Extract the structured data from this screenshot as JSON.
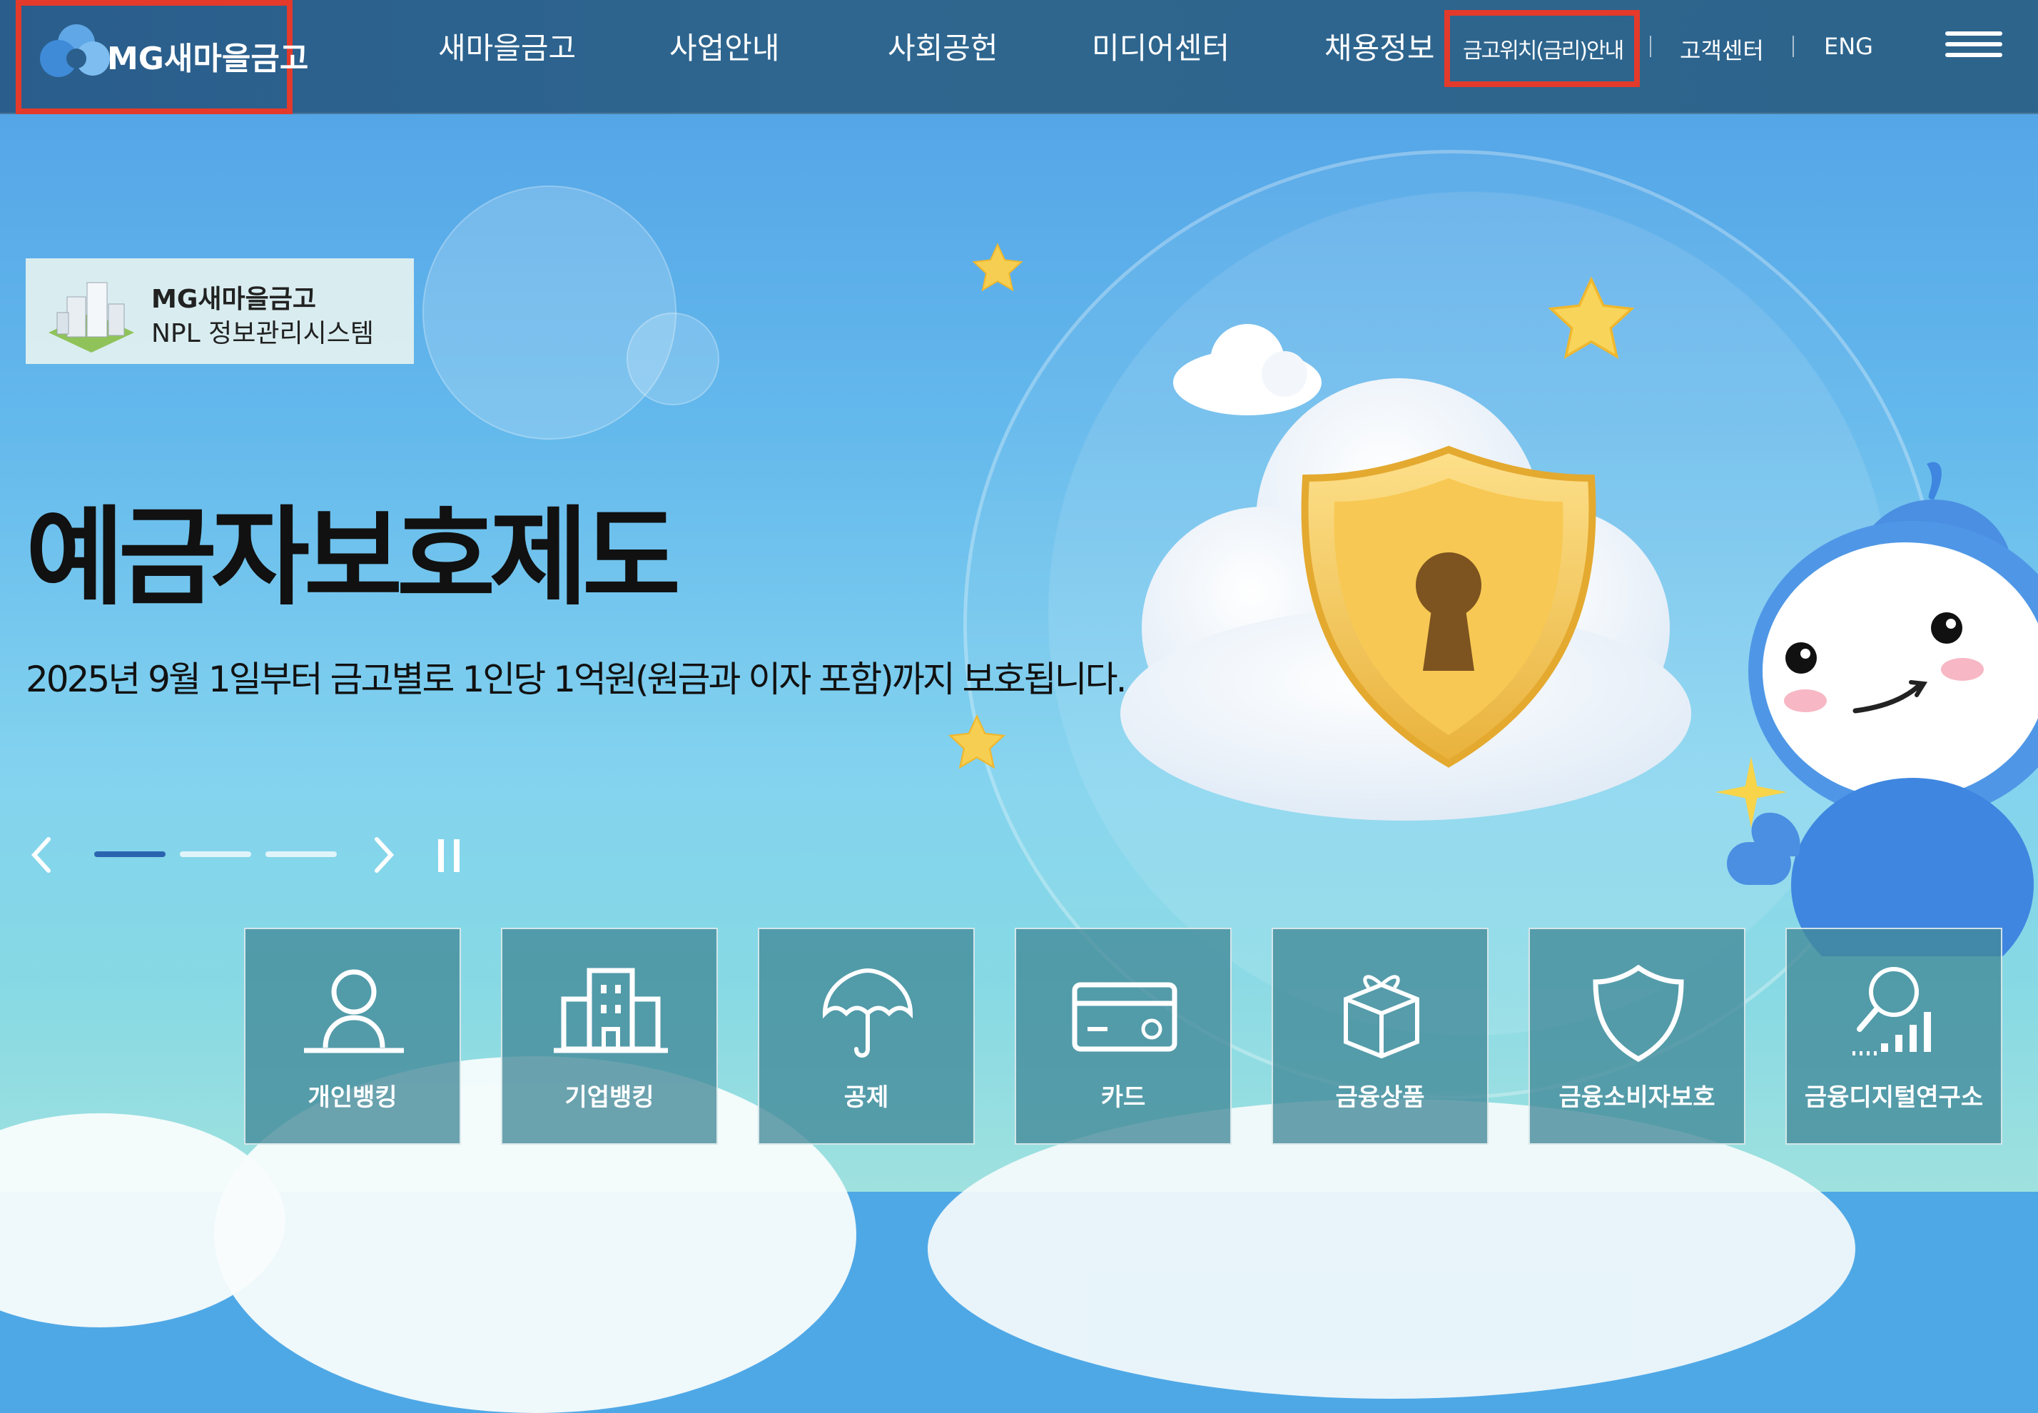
{
  "header": {
    "logo_text": "MG새마을금고",
    "nav": [
      "새마을금고",
      "사업안내",
      "사회공헌",
      "미디어센터",
      "채용정보"
    ],
    "utility": {
      "rate_info": "금고위치(금리)안내",
      "customer_center": "고객센터",
      "eng": "ENG"
    },
    "menu_icon": "hamburger-icon"
  },
  "npl_banner": {
    "title": "MG새마을금고",
    "subtitle": "NPL 정보관리시스템"
  },
  "hero": {
    "headline": "예금자보호제도",
    "subline": "2025년 9월 1일부터 금고별로 1인당 1억원(원금과 이자 포함)까지 보호됩니다.",
    "slide_count": 3,
    "active_slide": 1
  },
  "quick_menu": [
    {
      "label": "개인뱅킹",
      "icon": "person-icon"
    },
    {
      "label": "기업뱅킹",
      "icon": "building-icon"
    },
    {
      "label": "공제",
      "icon": "umbrella-icon"
    },
    {
      "label": "카드",
      "icon": "card-icon"
    },
    {
      "label": "금융상품",
      "icon": "gift-box-icon"
    },
    {
      "label": "금융소비자보호",
      "icon": "shield-icon"
    },
    {
      "label": "금융디지털연구소",
      "icon": "magnifier-chart-icon"
    }
  ],
  "colors": {
    "header_bg": "#2d648c",
    "highlight": "#e33a2b",
    "slider_active": "#2a64b0",
    "quick_tile": "#438999"
  }
}
